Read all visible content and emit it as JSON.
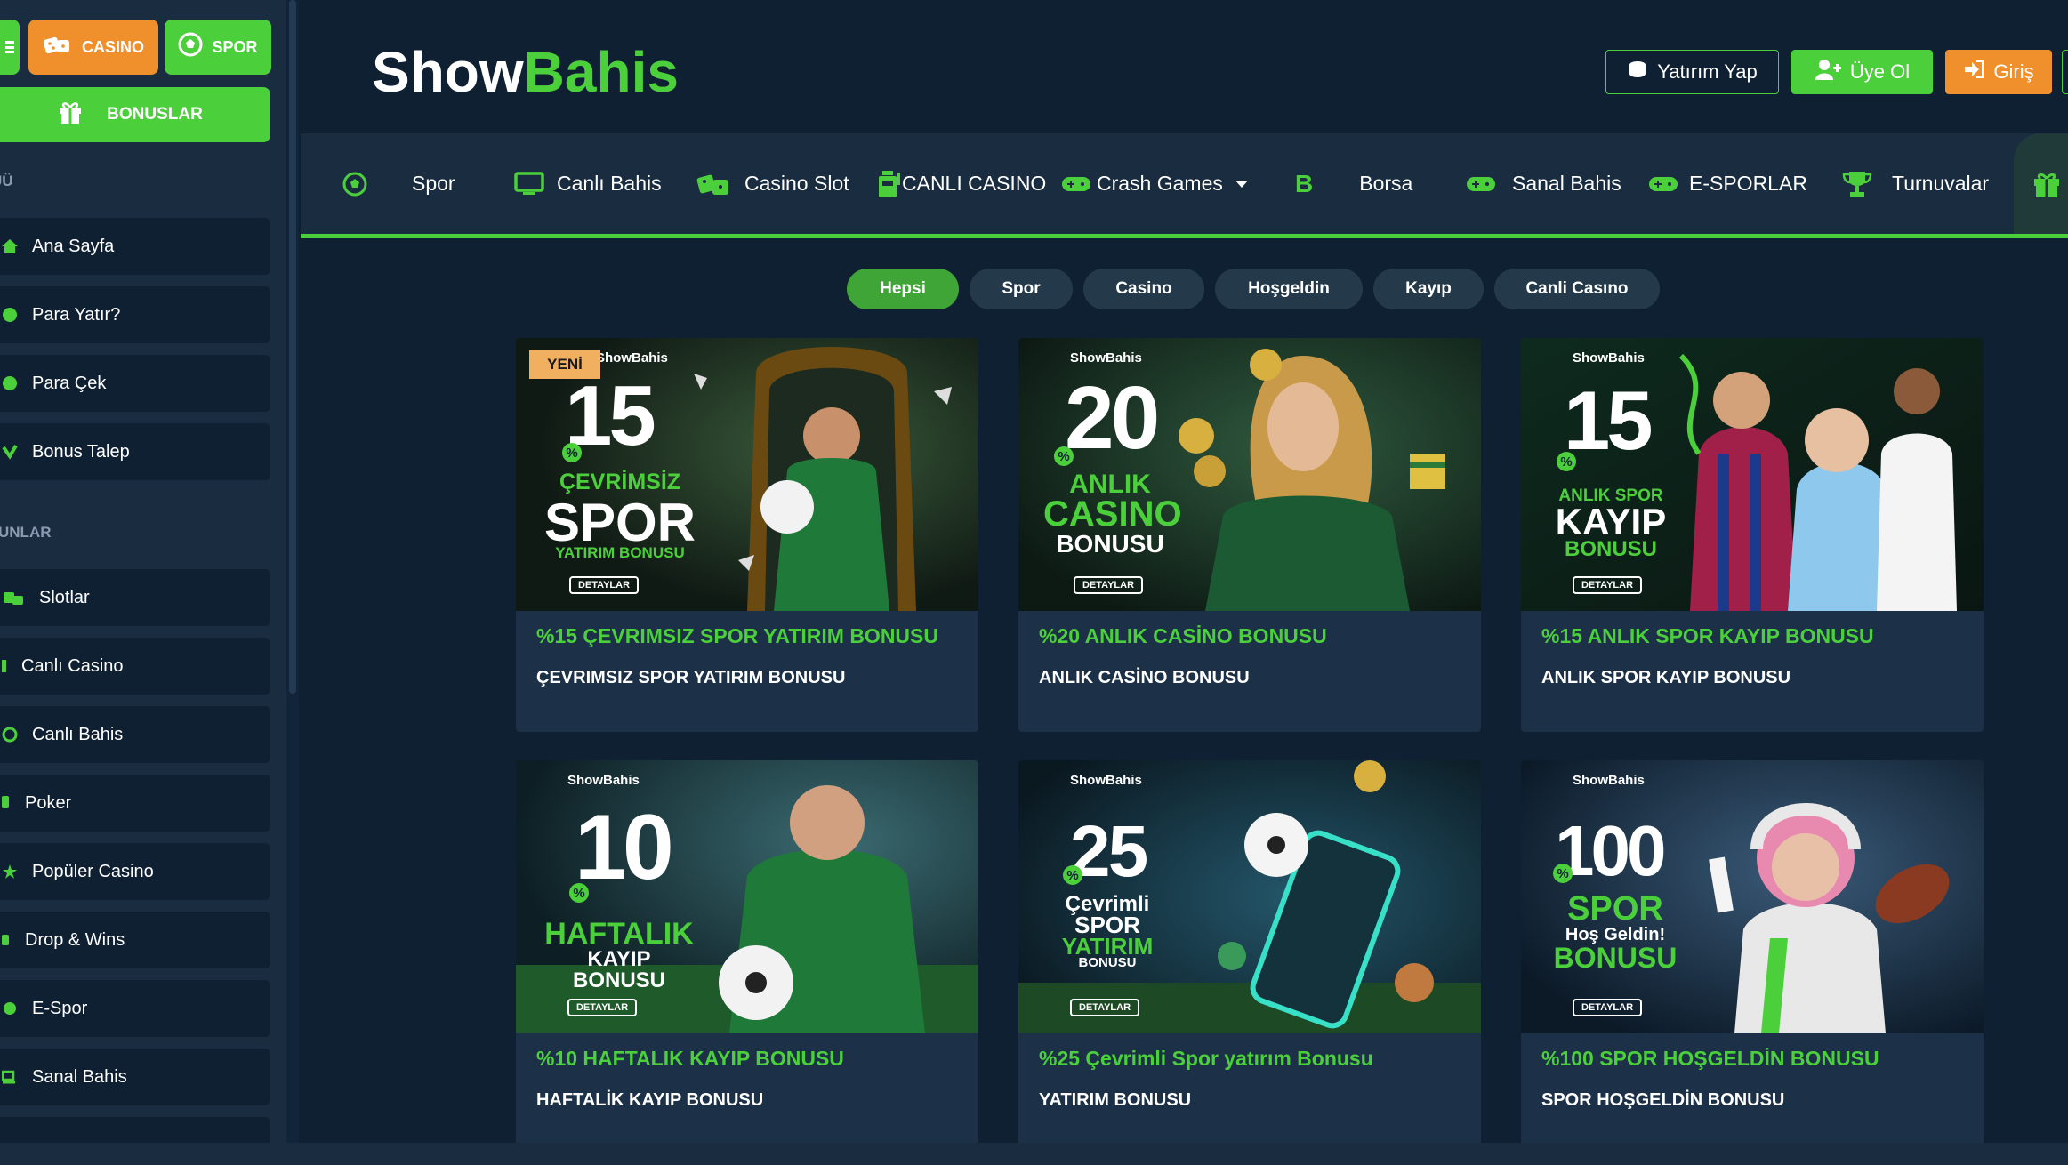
{
  "sidebar": {
    "casino_label": "CASINO",
    "spor_label": "SPOR",
    "bonuslar_label": "BONUSLAR",
    "menu_heading": "ÜÜ",
    "menu_items": [
      {
        "label": "Ana Sayfa",
        "icon": "home-icon"
      },
      {
        "label": "Para Yatır?",
        "icon": "coin-icon"
      },
      {
        "label": "Para Çek",
        "icon": "coin-icon"
      },
      {
        "label": "Bonus Talep",
        "icon": "gift-icon"
      }
    ],
    "games_heading": "UNLAR",
    "game_items": [
      {
        "label": "Slotlar",
        "icon": "dice-icon"
      },
      {
        "label": "Canlı Casino",
        "icon": "cards-icon"
      },
      {
        "label": "Canlı Bahis",
        "icon": "ball-icon"
      },
      {
        "label": "Poker",
        "icon": "poker-icon"
      },
      {
        "label": "Popüler Casino",
        "icon": "star-icon"
      },
      {
        "label": "Drop & Wins",
        "icon": "drop-icon"
      },
      {
        "label": "E-Spor",
        "icon": "gamepad-icon"
      },
      {
        "label": "Sanal Bahis",
        "icon": "monitor-icon"
      }
    ]
  },
  "header": {
    "logo_part1": "Show",
    "logo_part2": "Bahis",
    "deposit_label": "Yatırım Yap",
    "register_label": "Üye Ol",
    "login_label": "Giriş"
  },
  "nav": {
    "items": [
      {
        "label": "Spor",
        "icon": "football-icon"
      },
      {
        "label": "Canlı Bahis",
        "icon": "monitor-icon"
      },
      {
        "label": "Casino Slot",
        "icon": "dice-icon"
      },
      {
        "label": "CANLI CASINO",
        "icon": "slot-machine-icon"
      },
      {
        "label": "Crash Games",
        "icon": "gamepad-icon"
      },
      {
        "label": "Borsa",
        "icon": "bitcoin-icon"
      },
      {
        "label": "Sanal Bahis",
        "icon": "gamepad-icon"
      },
      {
        "label": "E-SPORLAR",
        "icon": "gamepad-icon"
      },
      {
        "label": "Turnuvalar",
        "icon": "trophy-icon"
      }
    ]
  },
  "filters": [
    "Hepsi",
    "Spor",
    "Casino",
    "Hoşgeldin",
    "Kayıp",
    "Canli Casıno"
  ],
  "cards": [
    {
      "title": "%15 ÇEVRIMSIZ SPOR YATIRIM BONUSU",
      "subtitle": "ÇEVRIMSIZ SPOR YATIRIM BONUSU",
      "badge": "YENİ",
      "banner": {
        "brand": "ShowBahis",
        "number": "15",
        "line1": "ÇEVRİMSİZ",
        "line2": "SPOR",
        "line3": "YATIRIM BONUSU",
        "detail": "DETAYLAR"
      }
    },
    {
      "title": "%20 ANLIK CASİNO BONUSU",
      "subtitle": "ANLIK CASİNO BONUSU",
      "banner": {
        "brand": "ShowBahis",
        "number": "20",
        "line1": "ANLIK",
        "line2": "CASINO",
        "line3": "BONUSU",
        "detail": "DETAYLAR"
      }
    },
    {
      "title": "%15 ANLIK SPOR KAYIP BONUSU",
      "subtitle": "ANLIK SPOR KAYIP BONUSU",
      "banner": {
        "brand": "ShowBahis",
        "number": "15",
        "line1": "ANLIK SPOR",
        "line2": "KAYIP",
        "line3": "BONUSU",
        "detail": "DETAYLAR"
      }
    },
    {
      "title": "%10 HAFTALIK KAYIP BONUSU",
      "subtitle": "HAFTALİK KAYIP BONUSU",
      "banner": {
        "brand": "ShowBahis",
        "number": "10",
        "line1": "HAFTALIK",
        "line2": "KAYIP BONUSU",
        "line3": "",
        "detail": "DETAYLAR"
      }
    },
    {
      "title": "%25 Çevrimli Spor yatırım Bonusu",
      "subtitle": "YATIRIM BONUSU",
      "banner": {
        "brand": "ShowBahis",
        "number": "25",
        "line1": "Çevrimli",
        "line2": "SPOR",
        "line3": "YATIRIM",
        "line4": "BONUSU",
        "detail": "DETAYLAR"
      }
    },
    {
      "title": "%100 SPOR HOŞGELDİN BONUSU",
      "subtitle": "SPOR HOŞGELDİN BONUSU",
      "banner": {
        "brand": "ShowBahis",
        "number": "100",
        "line1": "SPOR",
        "line2": "Hoş Geldin!",
        "line3": "BONUSU",
        "detail": "DETAYLAR"
      }
    }
  ],
  "colors": {
    "accent": "#4bd03c",
    "orange": "#f0902c",
    "background": "#0f2033",
    "panel": "#1a2d40"
  }
}
